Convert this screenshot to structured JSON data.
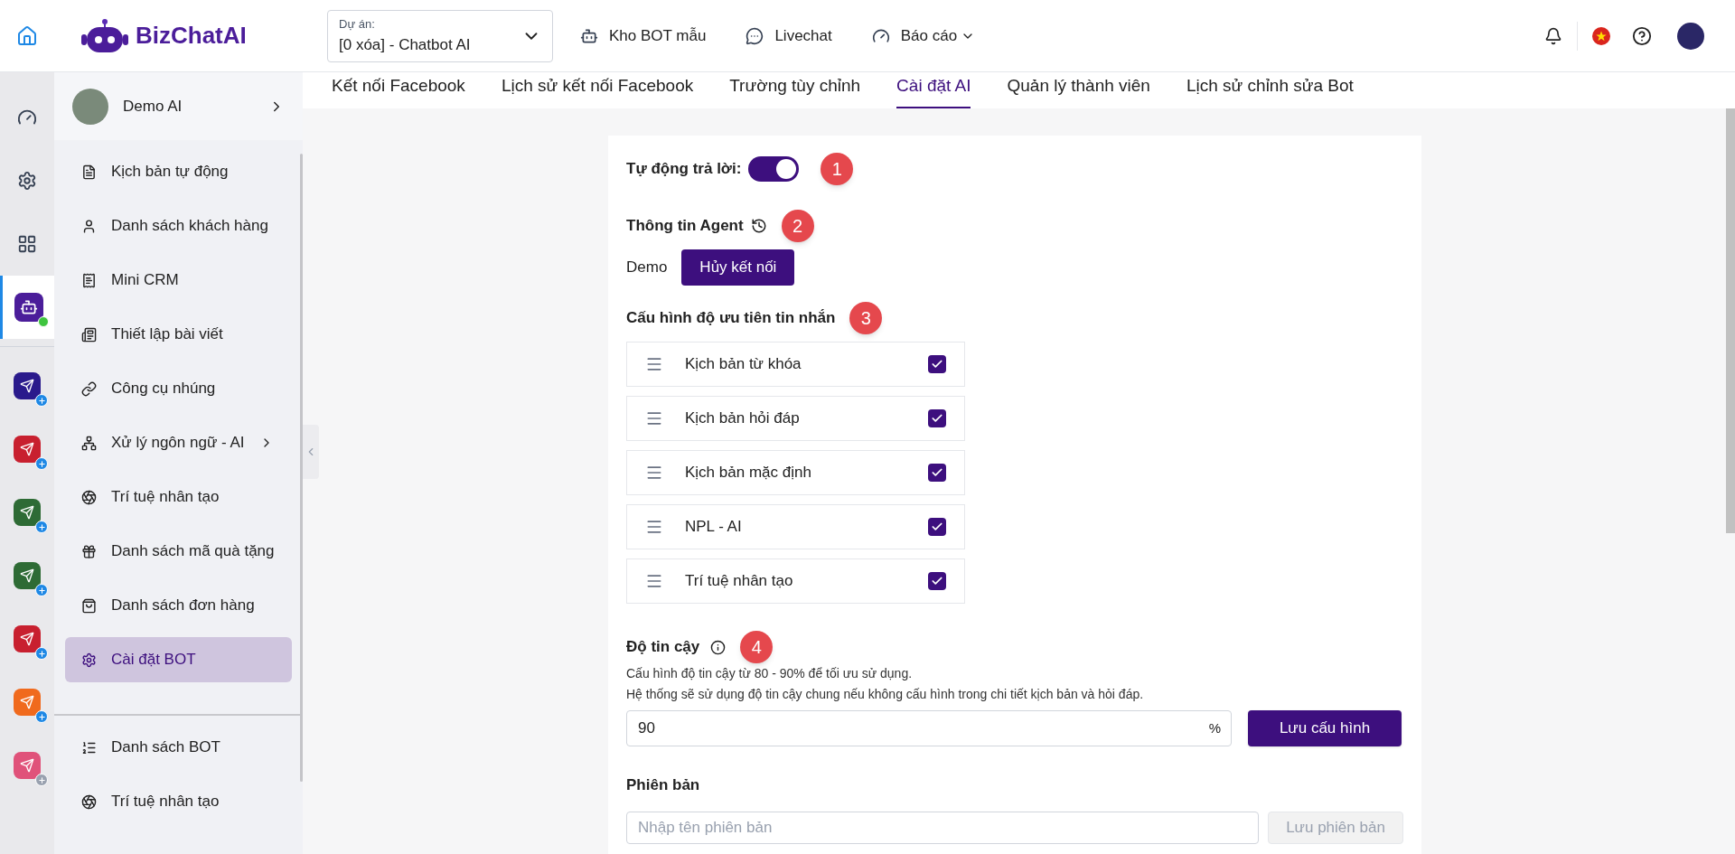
{
  "header": {
    "brand": "BizChatAI",
    "project": {
      "label": "Dự án:",
      "value": "[0 xóa] - Chatbot AI"
    },
    "nav": [
      {
        "label": "Kho BOT mẫu",
        "kind": "bot"
      },
      {
        "label": "Livechat",
        "kind": "chat"
      },
      {
        "label": "Báo cáo",
        "kind": "report",
        "dropdown": true
      }
    ]
  },
  "rail": [
    {
      "kind": "dashboard",
      "selected": false
    },
    {
      "kind": "settings",
      "selected": false
    },
    {
      "kind": "grid",
      "selected": false
    },
    {
      "kind": "bot",
      "selected": true,
      "online": true
    },
    {
      "kind": "app",
      "color": "#2a1a8c",
      "installed": false
    },
    {
      "kind": "app",
      "color": "#c8202f",
      "installed": false
    },
    {
      "kind": "app",
      "color": "#2e6b35",
      "installed": false
    },
    {
      "kind": "app",
      "color": "#2e6b35",
      "installed": false
    },
    {
      "kind": "app",
      "color": "#c8202f",
      "installed": false
    },
    {
      "kind": "app",
      "color": "#f06a1d",
      "installed": false
    },
    {
      "kind": "app",
      "color": "#e0527a",
      "installed": true
    }
  ],
  "sidebar": {
    "profile": {
      "name": "Demo AI"
    },
    "items": [
      {
        "label": "Kịch bản tự động",
        "selected": false
      },
      {
        "label": "Danh sách khách hàng",
        "selected": false
      },
      {
        "label": "Mini CRM",
        "selected": false
      },
      {
        "label": "Thiết lập bài viết",
        "selected": false
      },
      {
        "label": "Công cụ nhúng",
        "selected": false
      },
      {
        "label": "Xử lý ngôn ngữ - AI",
        "selected": false,
        "submenu": true
      },
      {
        "label": "Trí tuệ nhân tạo",
        "selected": false
      },
      {
        "label": "Danh sách mã quà tặng",
        "selected": false
      },
      {
        "label": "Danh sách đơn hàng",
        "selected": false
      },
      {
        "label": "Cài đặt BOT",
        "selected": true
      }
    ],
    "bottom_items": [
      {
        "label": "Danh sách BOT"
      },
      {
        "label": "Trí tuệ nhân tạo"
      }
    ]
  },
  "tabs": [
    {
      "label": "Kết nối Facebook",
      "selected": false
    },
    {
      "label": "Lịch sử kết nối Facebook",
      "selected": false
    },
    {
      "label": "Trường tùy chỉnh",
      "selected": false
    },
    {
      "label": "Cài đặt AI",
      "selected": true
    },
    {
      "label": "Quản lý thành viên",
      "selected": false
    },
    {
      "label": "Lịch sử chỉnh sửa Bot",
      "selected": false
    }
  ],
  "auto_reply": {
    "label": "Tự động trả lời:",
    "on": true,
    "step": "1"
  },
  "agent": {
    "title": "Thông tin Agent",
    "step": "2",
    "name": "Demo",
    "button": "Hủy kết nối"
  },
  "priority": {
    "title": "Cấu hình độ ưu tiên tin nhắn",
    "step": "3",
    "items": [
      {
        "label": "Kịch bản từ khóa",
        "checked": true
      },
      {
        "label": "Kịch bản hỏi đáp",
        "checked": true
      },
      {
        "label": "Kịch bản mặc định",
        "checked": true
      },
      {
        "label": "NPL - AI",
        "checked": true
      },
      {
        "label": "Trí tuệ nhân tạo",
        "checked": true
      }
    ]
  },
  "confidence": {
    "title": "Độ tin cậy",
    "step": "4",
    "notes": [
      "Cấu hình độ tin cậy từ 80 - 90% để tối ưu sử dụng.",
      "Hệ thống sẽ sử dụng độ tin cậy chung nếu không cấu hình trong chi tiết kịch bản và hỏi đáp."
    ],
    "value": "90",
    "unit": "%",
    "button": "Lưu cấu hình"
  },
  "version": {
    "title": "Phiên bản",
    "placeholder": "Nhập tên phiên bản",
    "button": "Lưu phiên bản",
    "button_disabled": true
  }
}
